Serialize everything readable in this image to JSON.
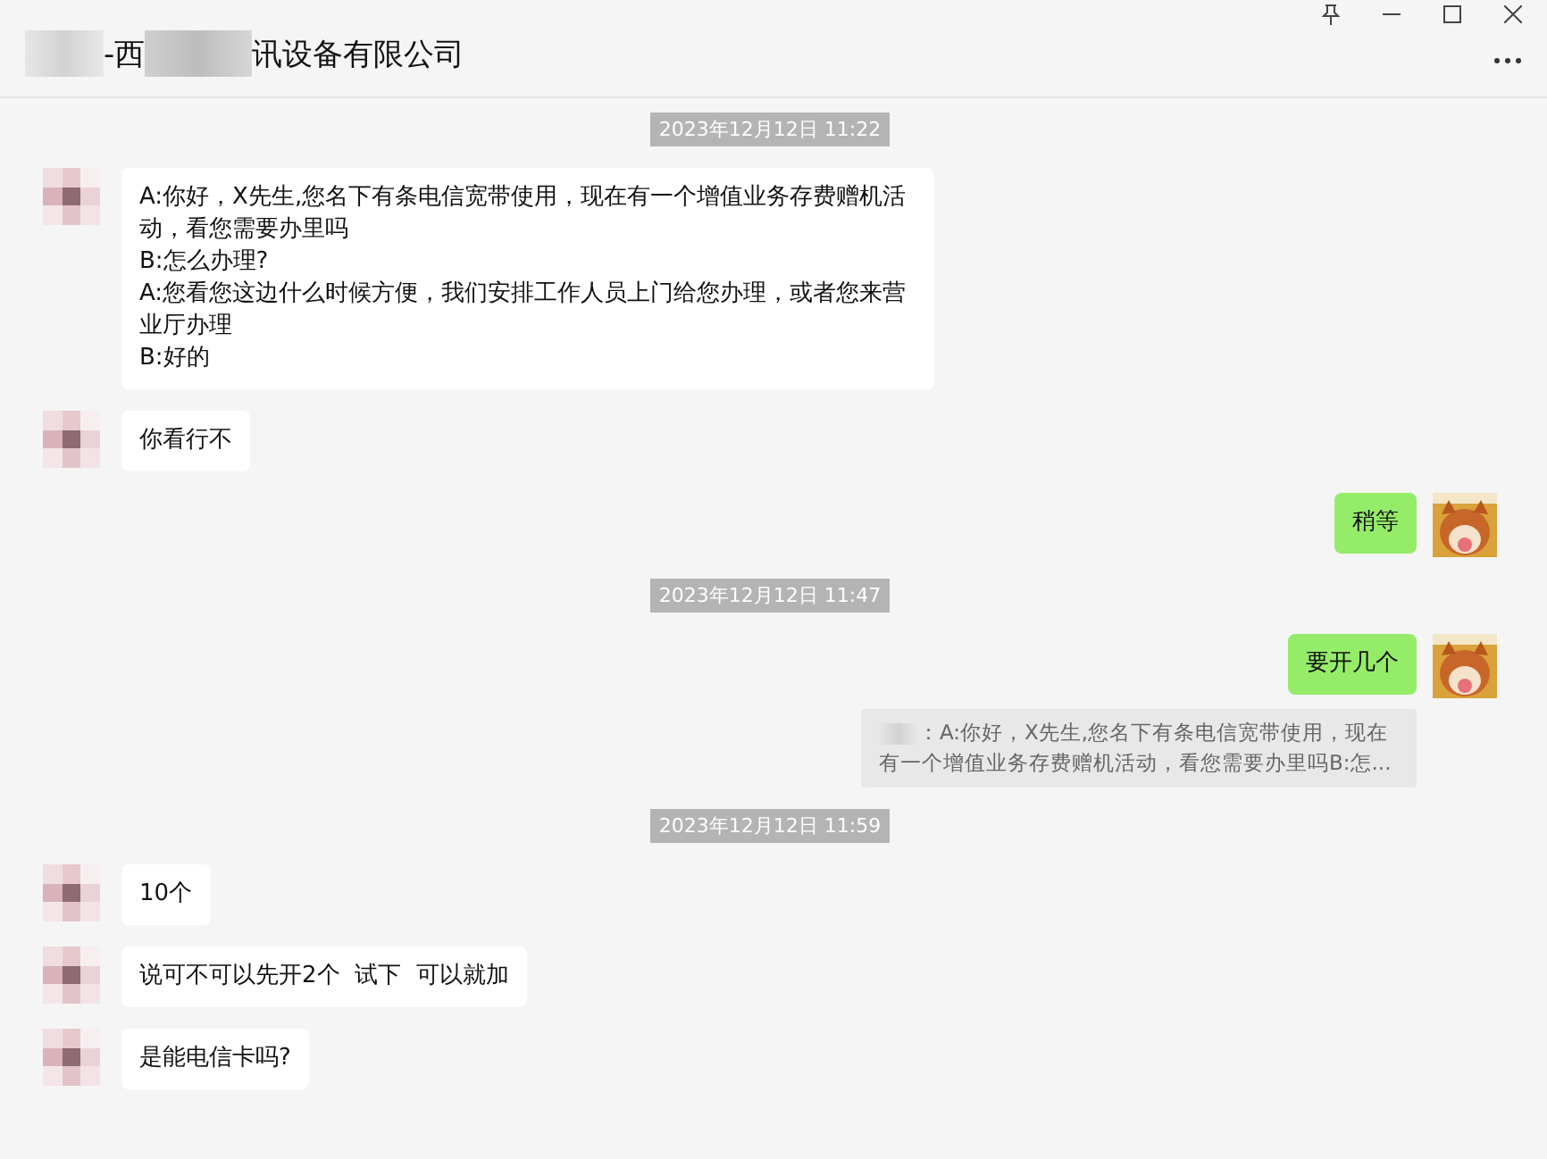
{
  "window": {
    "title_start": "-西",
    "title_end": "讯设备有限公司"
  },
  "messages": [
    {
      "kind": "timestamp",
      "text": "2023年12月12日 11:22"
    },
    {
      "kind": "incoming",
      "text": "A:你好，X先生,您名下有条电信宽带使用，现在有一个增值业务存费赠机活动，看您需要办里吗\nB:怎么办理?\nA:您看您这边什么时候方便，我们安排工作人员上门给您办理，或者您来营业厅办理\nB:好的"
    },
    {
      "kind": "incoming",
      "text": "你看行不"
    },
    {
      "kind": "outgoing",
      "text": "稍等"
    },
    {
      "kind": "timestamp",
      "text": "2023年12月12日 11:47"
    },
    {
      "kind": "outgoing",
      "text": "要开几个"
    },
    {
      "kind": "quote",
      "text": "：A:你好，X先生,您名下有条电信宽带使用，现在有一个增值业务存费赠机活动，看您需要办里吗B:怎..."
    },
    {
      "kind": "timestamp",
      "text": "2023年12月12日 11:59"
    },
    {
      "kind": "incoming",
      "text": "10个"
    },
    {
      "kind": "incoming",
      "text": "说可不可以先开2个  试下  可以就加"
    },
    {
      "kind": "incoming",
      "text": "是能电信卡吗?"
    }
  ]
}
